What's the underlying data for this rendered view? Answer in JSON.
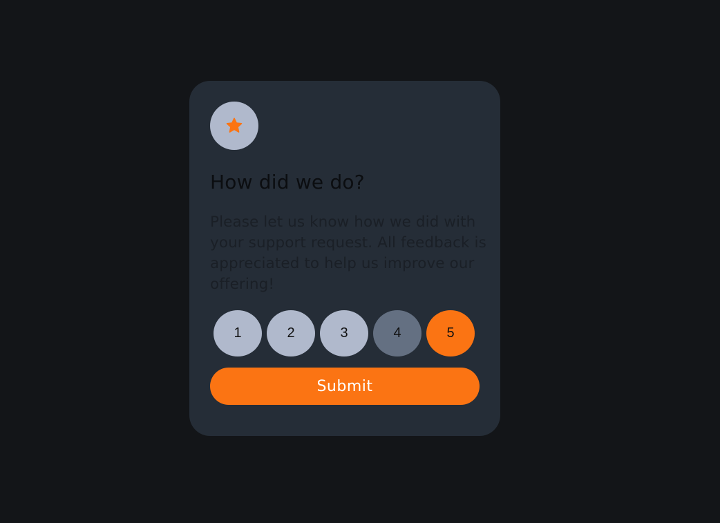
{
  "card": {
    "icon": "star-icon",
    "title": "How did we do?",
    "description": "Please let us know how we did with your support request. All feedback is appreciated to help us improve our offering!"
  },
  "ratings": {
    "options": [
      "1",
      "2",
      "3",
      "4",
      "5"
    ],
    "selected": "5"
  },
  "submit": {
    "label": "Submit"
  },
  "colors": {
    "background": "#131518",
    "card": "#252d37",
    "accent": "#fb7413",
    "rating_default": "#b0b9cc",
    "rating_hover": "#647082"
  }
}
